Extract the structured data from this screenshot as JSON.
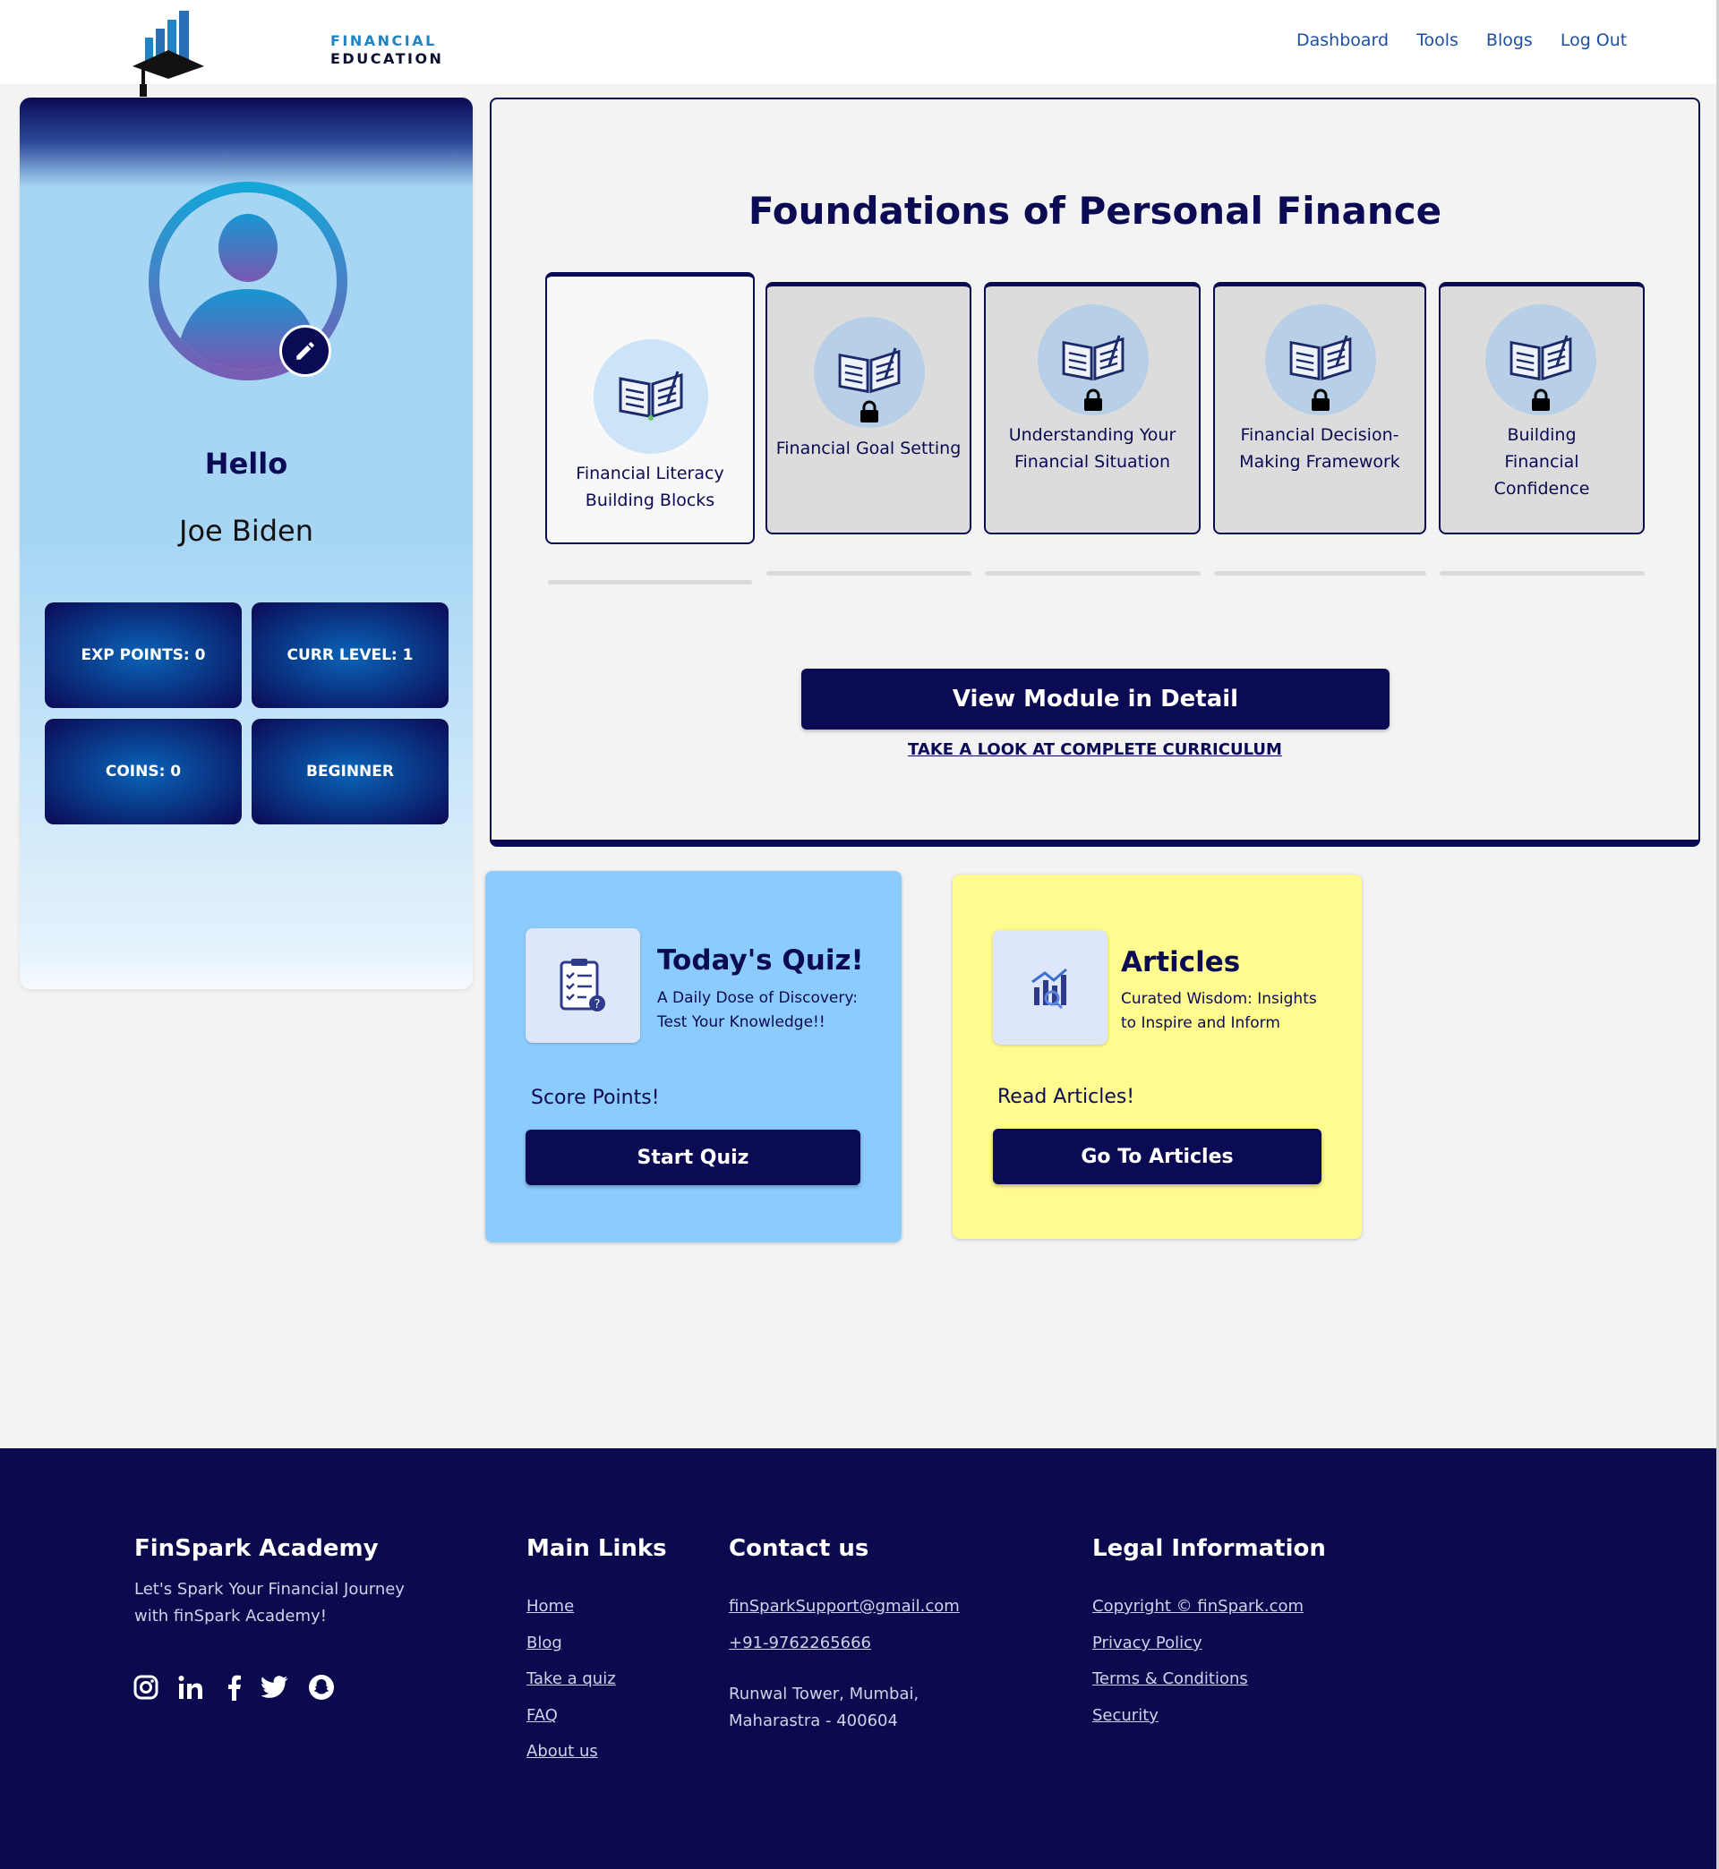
{
  "header": {
    "logo": {
      "line1": "FINANCIAL",
      "line2": "EDUCATION"
    },
    "nav": [
      "Dashboard",
      "Tools",
      "Blogs",
      "Log Out"
    ]
  },
  "profile": {
    "greeting": "Hello",
    "name": "Joe Biden",
    "stats": {
      "exp": "EXP POINTS: 0",
      "level": "CURR LEVEL: 1",
      "coins": "COINS: 0",
      "rank": "BEGINNER"
    }
  },
  "module": {
    "title": "Foundations of Personal Finance",
    "cards": [
      {
        "label": "Financial Literacy Building Blocks",
        "locked": false
      },
      {
        "label": "Financial Goal Setting",
        "locked": true
      },
      {
        "label": "Understanding Your Financial Situation",
        "locked": true
      },
      {
        "label": "Financial Decision-Making Framework",
        "locked": true
      },
      {
        "label": "Building Financial Confidence",
        "locked": true
      }
    ],
    "view_button": "View Module in Detail",
    "curriculum_link": "TAKE A LOOK AT COMPLETE CURRICULUM"
  },
  "quiz": {
    "title": "Today's Quiz!",
    "subtitle": "A Daily Dose of Discovery: Test Your Knowledge!!",
    "cta": "Score Points!",
    "button": "Start Quiz"
  },
  "articles": {
    "title": "Articles",
    "subtitle": "Curated Wisdom: Insights to Inspire and Inform",
    "cta": "Read Articles!",
    "button": "Go To Articles"
  },
  "footer": {
    "brand": {
      "title": "FinSpark Academy",
      "tagline": "Let's Spark Your Financial Journey with finSpark Academy!"
    },
    "social": [
      "instagram-icon",
      "linkedin-icon",
      "facebook-icon",
      "twitter-icon",
      "snapchat-icon"
    ],
    "main_links": {
      "title": "Main Links",
      "items": [
        "Home",
        "Blog",
        "Take a quiz",
        "FAQ",
        "About us"
      ]
    },
    "contact": {
      "title": "Contact us",
      "email": "finSparkSupport@gmail.com",
      "phone": "+91-9762265666",
      "address": "Runwal Tower, Mumbai, Maharastra - 400604"
    },
    "legal": {
      "title": "Legal Information",
      "items": [
        "Copyright © finSpark.com",
        "Privacy Policy",
        "Terms & Conditions",
        "Security"
      ]
    }
  },
  "colors": {
    "navy": "#0b0a55",
    "quiz_bg": "#8ccbfd",
    "articles_bg": "#fffb8f",
    "nav_link": "#1d4fa6"
  }
}
